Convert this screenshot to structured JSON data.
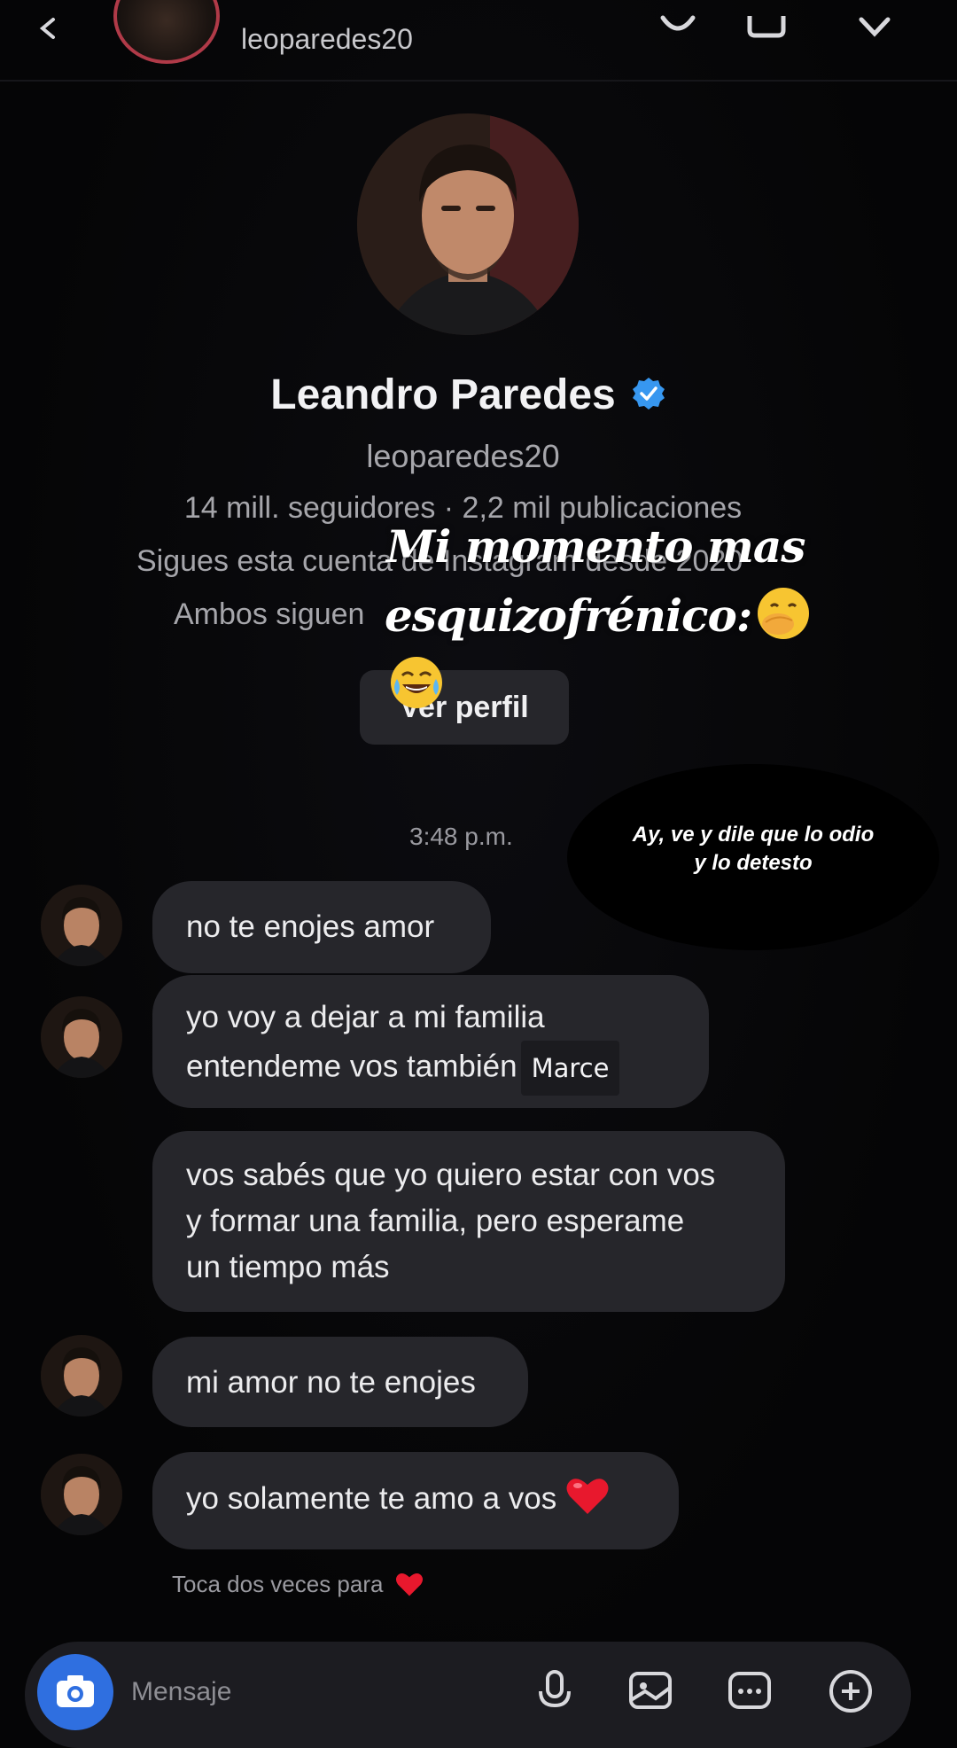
{
  "header": {
    "username": "leoparedes20"
  },
  "profile": {
    "name": "Leandro Paredes",
    "handle": "leoparedes20",
    "stats": "14 mill. seguidores · 2,2 mil publicaciones",
    "follow_since": "Sigues esta cuenta de Instagram desde 2020",
    "mutual": "Ambos siguen",
    "view_profile_label": "Ver perfil"
  },
  "overlay": {
    "title_line1": "Mi momento mas",
    "title_line2": "esquizofrénico:",
    "emojis": [
      "hand-over-mouth-emoji",
      "tears-of-joy-emoji"
    ],
    "caption_line1": "Ay, ve y dile que lo odio",
    "caption_line2": "y lo detesto"
  },
  "chat": {
    "timestamp": "3:48 p.m.",
    "messages": [
      {
        "text": "no te enojes amor"
      },
      {
        "line1": "yo voy a dejar a mi familia",
        "line2": "entendeme vos también",
        "tag": "Marce"
      },
      {
        "line1": "vos sabés que yo quiero estar con vos",
        "line2": "y formar una familia, pero esperame",
        "line3": "un tiempo más"
      },
      {
        "text": "mi amor no te enojes"
      },
      {
        "text": "yo solamente te amo a vos"
      }
    ],
    "reaction_hint": "Toca dos veces para"
  },
  "composer": {
    "placeholder": "Mensaje"
  },
  "colors": {
    "background": "#050506",
    "bubble": "#26262b",
    "accent_blue": "#2f6fe0",
    "verified_blue": "#3797f0",
    "heart_red": "#e8182d",
    "story_ring": "#b03a48"
  }
}
